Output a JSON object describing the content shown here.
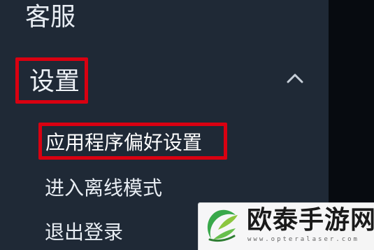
{
  "menu": {
    "top_item": "客服",
    "section": {
      "label": "设置",
      "expanded": true,
      "toggle_icon": "chevron-up-icon"
    },
    "items": [
      {
        "label": "应用程序偏好设置",
        "highlighted": true
      },
      {
        "label": "进入离线模式",
        "highlighted": false
      },
      {
        "label": "退出登录",
        "highlighted": false
      }
    ]
  },
  "watermark": {
    "title": "欧泰手游网",
    "url": "www.opteralaser.com",
    "logo_icon": "leaf-logo-icon"
  },
  "colors": {
    "panel_background": "#1f2936",
    "text": "#e8edf3",
    "highlight_border": "#d90011",
    "right_strip": "#070b10",
    "watermark_background": "#ffffff",
    "logo_green": "#39a84a"
  }
}
